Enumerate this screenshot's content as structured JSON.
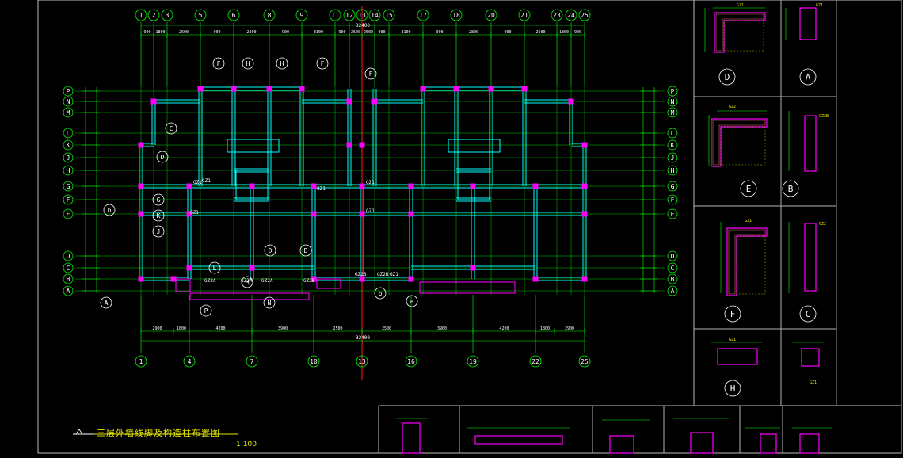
{
  "drawing": {
    "title": "三层外墙线脚及构造柱布置图",
    "scale": "1:100",
    "label_prefix": "1:"
  },
  "grids": {
    "top": [
      "1",
      "2",
      "3",
      "5",
      "6",
      "8",
      "9",
      "11",
      "12",
      "13",
      "14",
      "15",
      "17",
      "18",
      "20",
      "21",
      "23",
      "24",
      "25"
    ],
    "bottom": [
      "1",
      "4",
      "7",
      "10",
      "13",
      "16",
      "19",
      "22",
      "25"
    ],
    "rows": [
      "P",
      "N",
      "M",
      "L",
      "K",
      "J",
      "H",
      "G",
      "F",
      "E",
      "D",
      "C",
      "B",
      "A"
    ]
  },
  "dimensions": {
    "top_total": "32400",
    "bottom_total": "32400",
    "bottom_segments": [
      "2900",
      "1800",
      "4200",
      "3900",
      "2500",
      "2500",
      "3900",
      "4200",
      "1800",
      "2900"
    ],
    "top_segments": [
      "900",
      "1800",
      "2600",
      "900",
      "2800",
      "900",
      "3100",
      "900",
      "2500",
      "2500",
      "900",
      "3100",
      "900",
      "2800",
      "900",
      "2600",
      "1800",
      "900"
    ]
  },
  "details": [
    {
      "id": "D",
      "tag": "GZ1"
    },
    {
      "id": "A",
      "tag": "GZ1"
    },
    {
      "id": "E",
      "tag": "GZ2"
    },
    {
      "id": "B",
      "tag": "GZ2B"
    },
    {
      "id": "F",
      "tag": "GZ1"
    },
    {
      "id": "C",
      "tag": "GZ2"
    },
    {
      "id": "H",
      "tag": "GZ1"
    },
    {
      "id": "GZ1",
      "tag": "GZ1"
    }
  ],
  "column_tags": [
    "GZ1",
    "GZ1",
    "GZ1",
    "GZ1",
    "GZ2A",
    "GZ2A",
    "GZ2A",
    "GZ2B",
    "GZ2B",
    "GZ2B",
    "GZ1",
    "GZ1",
    "GZ1"
  ],
  "section_labels": [
    "D",
    "A",
    "E",
    "B",
    "F",
    "C",
    "H",
    "G",
    "L",
    "M",
    "N",
    "P",
    "K",
    "J",
    "a",
    "b"
  ],
  "colors": {
    "bg": "#000000",
    "grid": "#00ff00",
    "axis_red": "#ff2020",
    "wall": "#00ffff",
    "wall_dark": "#2a7f9f",
    "column": "#ff00ff",
    "text_yellow": "#e6e600",
    "white": "#ffffff",
    "frame": "#bbbbbb"
  }
}
